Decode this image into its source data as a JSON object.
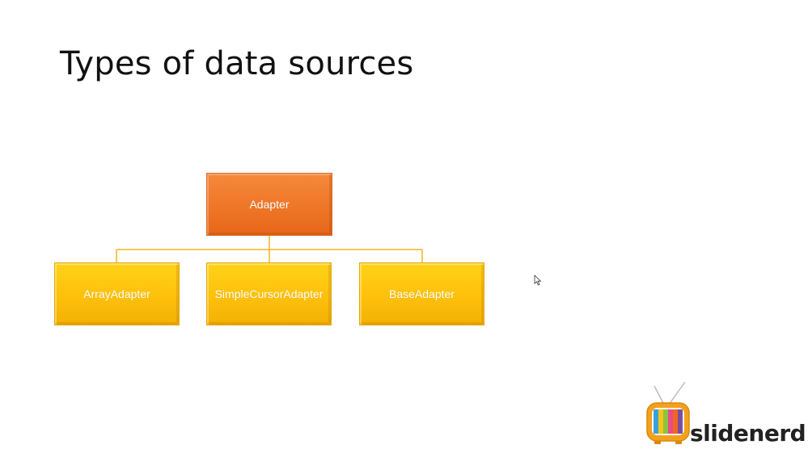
{
  "slide": {
    "title": "Types of data sources"
  },
  "diagram": {
    "root": {
      "label": "Adapter"
    },
    "children": [
      {
        "label": "ArrayAdapter"
      },
      {
        "label": "SimpleCursorAdapter"
      },
      {
        "label": "BaseAdapter"
      }
    ]
  },
  "logo": {
    "text": "slidenerd"
  },
  "colors": {
    "root_fill": "#f07a2a",
    "child_fill": "#ffc20c",
    "connector": "#f2b51a"
  },
  "icons": [
    "tv-icon",
    "mouse-cursor-icon"
  ]
}
